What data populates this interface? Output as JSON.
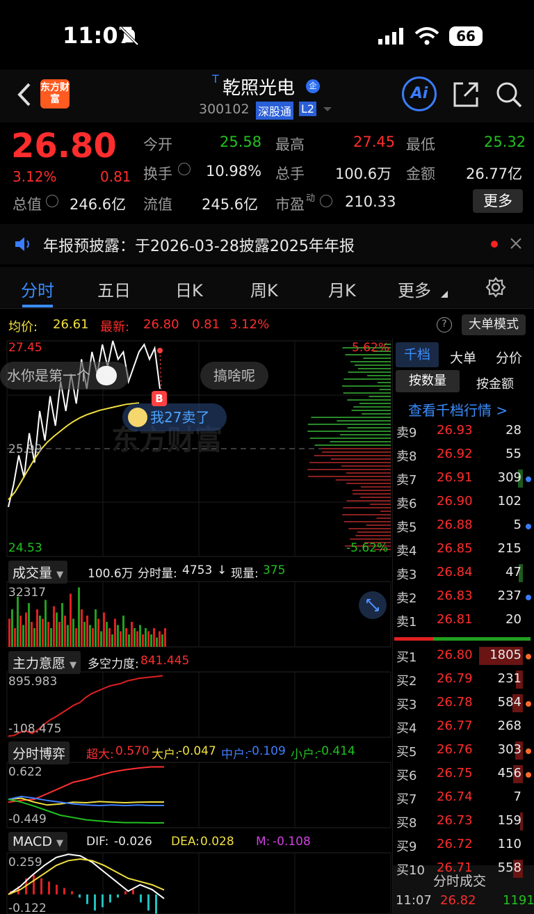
{
  "status": {
    "time": "11:07",
    "battery": "66"
  },
  "header": {
    "logo": "东方财富",
    "t_badge": "T",
    "title": "乾照光电",
    "corp_badge": "企",
    "code": "300102",
    "tag": "深股通",
    "level": "L2",
    "ai": "Ai"
  },
  "quote": {
    "price": "26.80",
    "change_pct": "3.12%",
    "change": "0.81",
    "rows": [
      {
        "l1": "今开",
        "v1": "25.58",
        "l2": "最高",
        "v2": "27.45",
        "l3": "最低",
        "v3": "25.32"
      },
      {
        "l1": "换手",
        "v1": "10.98%",
        "l2": "总手",
        "v2": "100.6万",
        "l3": "金额",
        "v3": "26.77亿"
      },
      {
        "l1": "总值",
        "v1": "246.6亿",
        "l2": "流值",
        "v2": "245.6亿",
        "l3": "市盈",
        "l3sup": "动",
        "v3": "210.33"
      }
    ],
    "more": "更多"
  },
  "notice": {
    "text": "年报预披露：于2026-03-28披露2025年年报"
  },
  "tabs": [
    "分时",
    "五日",
    "日K",
    "周K",
    "月K",
    "更多"
  ],
  "chart_header": {
    "avg_label": "均价:",
    "avg": "26.61",
    "latest_label": "最新:",
    "latest": "26.80",
    "chg": "0.81",
    "pct": "3.12%",
    "mode": "大单模式"
  },
  "chart_data": [
    {
      "type": "line",
      "name": "intraday",
      "ylim": [
        24.53,
        27.45
      ],
      "prev_close": "25.99",
      "ticks": {
        "top": "27.45",
        "bottom": "24.53",
        "mid": "25.99",
        "top_pct": "5.62%",
        "bottom_pct": "-5.62%"
      },
      "series": [
        {
          "color": "#ffffff",
          "values": [
            25.2,
            25.5,
            25.9,
            25.6,
            26.2,
            25.8,
            26.5,
            26.1,
            26.7,
            26.3,
            26.9,
            26.5,
            27.0,
            26.6,
            27.2,
            26.8,
            27.3,
            27.0,
            27.4,
            27.1,
            27.45,
            27.2,
            27.3,
            26.9,
            27.1,
            27.3,
            27.4,
            27.2,
            27.35,
            26.8
          ]
        },
        {
          "color": "#f0e040",
          "values": [
            25.3,
            25.4,
            25.55,
            25.7,
            25.85,
            25.98,
            26.08,
            26.16,
            26.23,
            26.3,
            26.36,
            26.41,
            26.45,
            26.48,
            26.51,
            26.53,
            26.55,
            26.57,
            26.59,
            26.6,
            26.61
          ]
        }
      ],
      "annotations": [
        {
          "text": "水你是第一个"
        },
        {
          "text": "搞啥呢"
        },
        {
          "text": "我27卖了"
        },
        {
          "text": "B"
        }
      ],
      "watermark": "东方财富"
    },
    {
      "type": "bar",
      "name": "成交量",
      "label": "成交量",
      "total": "100.6万",
      "period_label": "分时量:",
      "period": "4753",
      "now_label": "现量:",
      "now": "375",
      "top_tick": "32317",
      "values": [
        0.45,
        0.6,
        0.3,
        0.8,
        0.5,
        0.35,
        0.55,
        0.7,
        0.4,
        0.3,
        0.6,
        0.5,
        0.45,
        0.75,
        0.4,
        0.3,
        0.65,
        0.55,
        0.4,
        0.7,
        0.5,
        0.35,
        0.85,
        0.45,
        0.3,
        0.95,
        0.6,
        0.4,
        0.5,
        0.35,
        0.3,
        0.6,
        0.45,
        0.25,
        0.55,
        0.4,
        0.3,
        0.2,
        0.45,
        0.35,
        0.25,
        0.5,
        0.3,
        0.2,
        0.4,
        0.3,
        0.25,
        0.35,
        0.2,
        0.3,
        0.25,
        0.2,
        0.3,
        0.15,
        0.25,
        0.2,
        0.3
      ],
      "colors_red_green": "alternating"
    },
    {
      "type": "line",
      "name": "主力意愿",
      "label": "主力意愿",
      "force_label": "多空力度:",
      "force": "841.445",
      "top_tick": "895.983",
      "bottom_tick": "-108.475",
      "series": [
        {
          "color": "#e02020",
          "values": [
            -100,
            -90,
            -40,
            -20,
            -60,
            0,
            80,
            150,
            200,
            260,
            320,
            380,
            420,
            500,
            560,
            600,
            640,
            680,
            700,
            720,
            760,
            780,
            800,
            810,
            820,
            830,
            841
          ]
        }
      ]
    },
    {
      "type": "line",
      "name": "分时博弈",
      "label": "分时博弈",
      "top_tick": "0.622",
      "bottom_tick": "-0.449",
      "legend": [
        {
          "name": "超大:",
          "value": "0.570",
          "color": "#ff3030"
        },
        {
          "name": "大户:",
          "value": "-0.047",
          "color": "#f0e040"
        },
        {
          "name": "中户:",
          "value": "-0.109",
          "color": "#3f7fff"
        },
        {
          "name": "小户:",
          "value": "-0.414",
          "color": "#21c121"
        }
      ],
      "series": [
        {
          "color": "#ff3030",
          "values": [
            -0.05,
            -0.02,
            0.0,
            0.1,
            0.2,
            0.3,
            0.35,
            0.42,
            0.48,
            0.52,
            0.55,
            0.57,
            0.57
          ]
        },
        {
          "color": "#f0e040",
          "values": [
            0.0,
            0.02,
            -0.05,
            -0.1,
            -0.08,
            -0.05,
            -0.06,
            -0.04,
            -0.05,
            -0.06,
            -0.05,
            -0.047,
            -0.047
          ]
        },
        {
          "color": "#3f7fff",
          "values": [
            0.0,
            0.05,
            0.02,
            -0.02,
            -0.05,
            -0.08,
            -0.1,
            -0.11,
            -0.1,
            -0.11,
            -0.1,
            -0.109,
            -0.109
          ]
        },
        {
          "color": "#21c121",
          "values": [
            0.0,
            -0.05,
            -0.12,
            -0.2,
            -0.28,
            -0.32,
            -0.36,
            -0.38,
            -0.4,
            -0.41,
            -0.41,
            -0.414,
            -0.414
          ]
        }
      ]
    },
    {
      "type": "line",
      "name": "MACD",
      "label": "MACD",
      "top_tick": "0.259",
      "bottom_tick": "-0.122",
      "legend": [
        {
          "name": "DIF:",
          "value": "-0.026",
          "color": "#ffffff"
        },
        {
          "name": "DEA:",
          "value": "0.028",
          "color": "#f0e040"
        },
        {
          "name": "M:",
          "value": "-0.108",
          "color": "#d040e0"
        }
      ],
      "series": [
        {
          "color": "#ffffff",
          "values": [
            0.0,
            0.05,
            0.12,
            0.18,
            0.23,
            0.25,
            0.24,
            0.2,
            0.14,
            0.08,
            0.02,
            0.06,
            0.03,
            -0.026
          ]
        },
        {
          "color": "#f0e040",
          "values": [
            0.0,
            0.03,
            0.08,
            0.13,
            0.18,
            0.21,
            0.22,
            0.21,
            0.18,
            0.14,
            0.1,
            0.08,
            0.06,
            0.028
          ]
        }
      ],
      "bars": [
        0.02,
        0.05,
        0.1,
        0.12,
        0.1,
        0.08,
        0.06,
        0.04,
        0.02,
        -0.02,
        -0.06,
        -0.1,
        -0.08,
        -0.05,
        -0.02,
        0.02,
        0.03,
        -0.05,
        -0.1,
        -0.12
      ]
    }
  ],
  "orderbook": {
    "tabs": [
      "千档",
      "大单",
      "分价"
    ],
    "sub_tabs": [
      "按数量",
      "按金额"
    ],
    "view_link": "查看千档行情 >",
    "asks": [
      {
        "label": "卖9",
        "price": "26.93",
        "vol": "28"
      },
      {
        "label": "卖8",
        "price": "26.92",
        "vol": "55"
      },
      {
        "label": "卖7",
        "price": "26.91",
        "vol": "309"
      },
      {
        "label": "卖6",
        "price": "26.90",
        "vol": "102"
      },
      {
        "label": "卖5",
        "price": "26.88",
        "vol": "5"
      },
      {
        "label": "卖4",
        "price": "26.85",
        "vol": "215"
      },
      {
        "label": "卖3",
        "price": "26.84",
        "vol": "47"
      },
      {
        "label": "卖2",
        "price": "26.83",
        "vol": "237"
      },
      {
        "label": "卖1",
        "price": "26.81",
        "vol": "20"
      }
    ],
    "bids": [
      {
        "label": "买1",
        "price": "26.80",
        "vol": "1805"
      },
      {
        "label": "买2",
        "price": "26.79",
        "vol": "231"
      },
      {
        "label": "买3",
        "price": "26.78",
        "vol": "584"
      },
      {
        "label": "买4",
        "price": "26.77",
        "vol": "268"
      },
      {
        "label": "买5",
        "price": "26.76",
        "vol": "303"
      },
      {
        "label": "买6",
        "price": "26.75",
        "vol": "456"
      },
      {
        "label": "买7",
        "price": "26.74",
        "vol": "7"
      },
      {
        "label": "买8",
        "price": "26.73",
        "vol": "159"
      },
      {
        "label": "买9",
        "price": "26.72",
        "vol": "110"
      },
      {
        "label": "买10",
        "price": "26.71",
        "vol": "558"
      }
    ],
    "trades_title": "分时成交",
    "trade": {
      "time": "11:07",
      "price": "26.82",
      "vol": "1191"
    }
  }
}
